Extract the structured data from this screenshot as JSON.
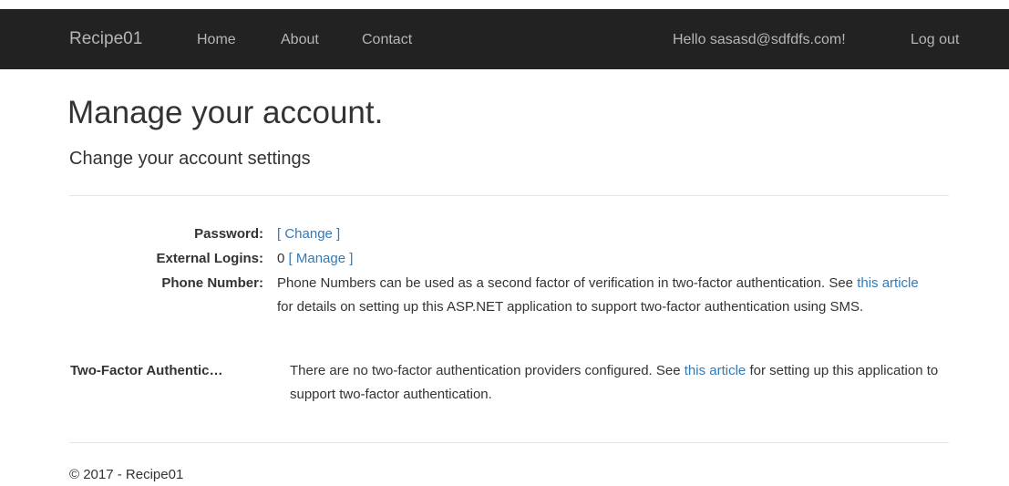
{
  "navbar": {
    "brand": "Recipe01",
    "links": [
      "Home",
      "About",
      "Contact"
    ],
    "greeting": "Hello sasasd@sdfdfs.com!",
    "logout": "Log out"
  },
  "page": {
    "title": "Manage your account.",
    "subtitle": "Change your account settings"
  },
  "settings": {
    "password": {
      "label": "Password:",
      "link": "[ Change ]"
    },
    "external": {
      "label": "External Logins:",
      "count": "0",
      "link": "[ Manage ]"
    },
    "phone": {
      "label": "Phone Number:",
      "text_before": "Phone Numbers can be used as a second factor of verification in two-factor authentication. See ",
      "link": "this article",
      "text_after": " for details on setting up this ASP.NET application to support two-factor authentication using SMS."
    },
    "twofactor": {
      "label": "Two-Factor Authentic…",
      "text_before": "There are no two-factor authentication providers configured. See ",
      "link": "this article",
      "text_after": " for setting up this application to support two-factor authentication."
    }
  },
  "footer": {
    "text": "© 2017 - Recipe01"
  }
}
